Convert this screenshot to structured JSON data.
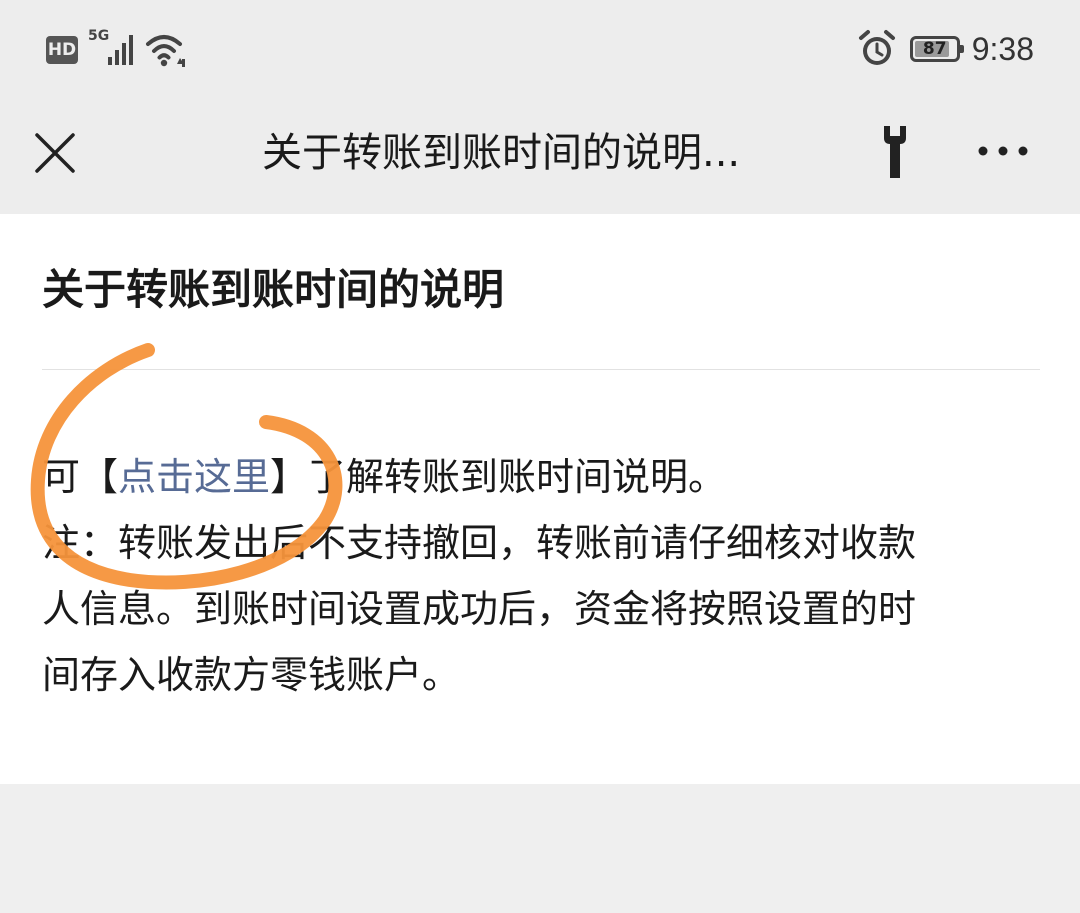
{
  "status_bar": {
    "hd_label": "HD",
    "network_label": "5G",
    "battery_level": "87",
    "time": "9:38",
    "icons": [
      "hd-icon",
      "signal-5g-icon",
      "wifi-icon",
      "alarm-icon",
      "battery-icon"
    ]
  },
  "nav": {
    "title": "关于转账到账时间的说明...",
    "icons": [
      "close-icon",
      "wrench-icon",
      "more-icon"
    ]
  },
  "article": {
    "title": "关于转账到账时间的说明",
    "line1_prefix": "可【",
    "link_text": "点击这里",
    "line1_suffix": "】了解转账到账时间说明。",
    "note_line1": "注：转账发出后不支持撤回，转账前请仔细核对收款",
    "note_line2": "人信息。到账时间设置成功后，资金将按照设置的时",
    "note_line3": "间存入收款方零钱账户。"
  },
  "colors": {
    "link": "#576b95",
    "annotation_stroke": "#f5943b",
    "chrome_background": "#ededed",
    "content_background": "#ffffff"
  }
}
